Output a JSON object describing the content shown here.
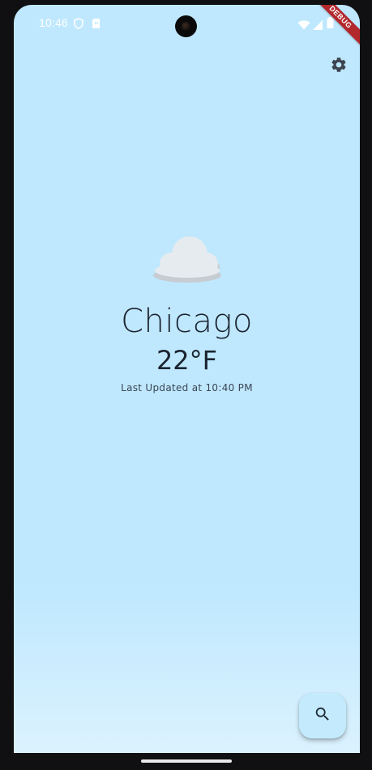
{
  "status_bar": {
    "time": "10:46",
    "icons": [
      "shield-icon",
      "sim-card-icon",
      "wifi-icon",
      "signal-icon",
      "battery-icon"
    ]
  },
  "debug_banner": {
    "label": "DEBUG"
  },
  "toolbar": {
    "settings_icon": "gear-icon"
  },
  "weather": {
    "condition_icon": "cloud-icon",
    "city": "Chicago",
    "temperature": "22°F",
    "last_updated": "Last Updated at 10:40 PM"
  },
  "fab": {
    "icon": "search-icon"
  },
  "colors": {
    "background": "#bfe8fe",
    "text_primary": "#1c2431",
    "fab_background": "#c3ebfd",
    "debug_banner": "#b3282d"
  }
}
